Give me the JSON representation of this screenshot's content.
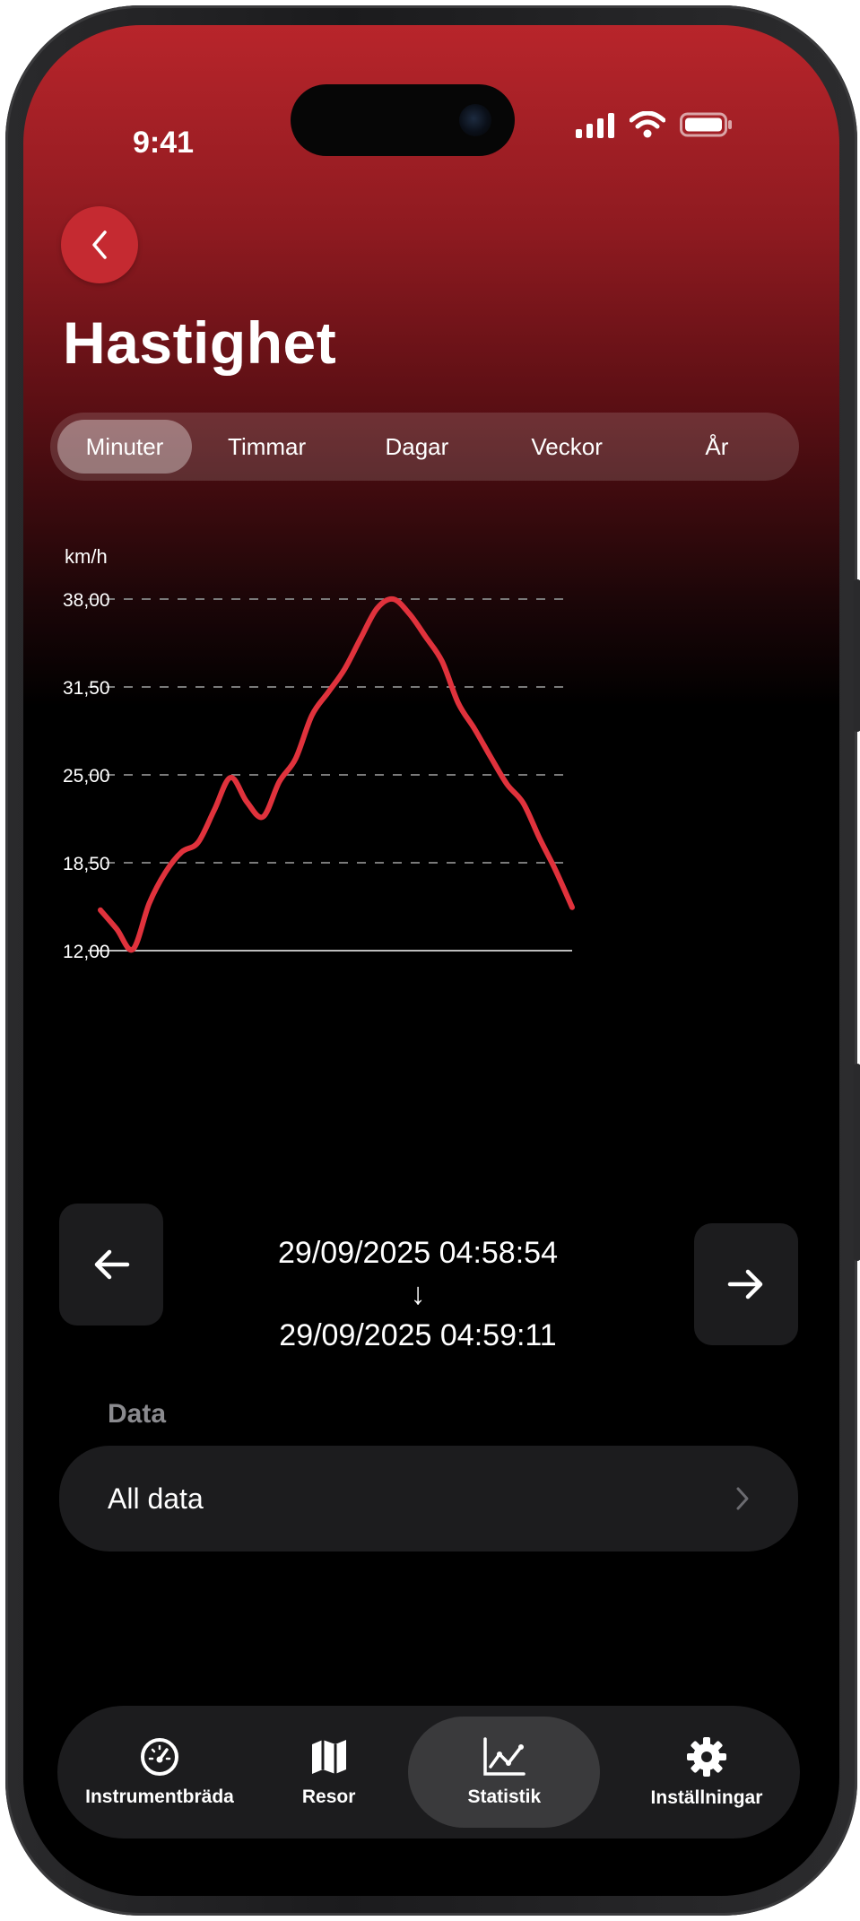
{
  "status_bar": {
    "time": "9:41"
  },
  "header": {
    "title": "Hastighet"
  },
  "segments": [
    {
      "label": "Minuter",
      "active": true
    },
    {
      "label": "Timmar",
      "active": false
    },
    {
      "label": "Dagar",
      "active": false
    },
    {
      "label": "Veckor",
      "active": false
    },
    {
      "label": "År",
      "active": false
    }
  ],
  "chart_data": {
    "type": "line",
    "ylabel": "km/h",
    "ylim": [
      12,
      38
    ],
    "yticks": [
      "38,00",
      "31,50",
      "25,00",
      "18,50",
      "12,00"
    ],
    "grid": "dashed horizontal",
    "line_color": "#e0323c",
    "values": [
      15.0,
      13.6,
      12.1,
      15.5,
      17.8,
      19.3,
      20.0,
      22.4,
      24.8,
      23.0,
      21.9,
      24.5,
      26.2,
      29.4,
      31.1,
      32.8,
      35.1,
      37.3,
      38.0,
      36.9,
      35.2,
      33.4,
      30.3,
      28.4,
      26.3,
      24.3,
      22.9,
      20.3,
      17.9,
      15.2
    ]
  },
  "range": {
    "start": "29/09/2025 04:58:54",
    "arrow": "↓",
    "end": "29/09/2025 04:59:11"
  },
  "data_section": {
    "label": "Data",
    "row_label": "All data"
  },
  "tabbar": [
    {
      "label": "Instrumentbräda",
      "icon": "speedometer-icon",
      "active": false
    },
    {
      "label": "Resor",
      "icon": "map-icon",
      "active": false
    },
    {
      "label": "Statistik",
      "icon": "chart-icon",
      "active": true
    },
    {
      "label": "Inställningar",
      "icon": "gear-icon",
      "active": false
    }
  ],
  "colors": {
    "accent": "#c52a31",
    "line": "#e0323c",
    "card": "#1c1c1e"
  }
}
